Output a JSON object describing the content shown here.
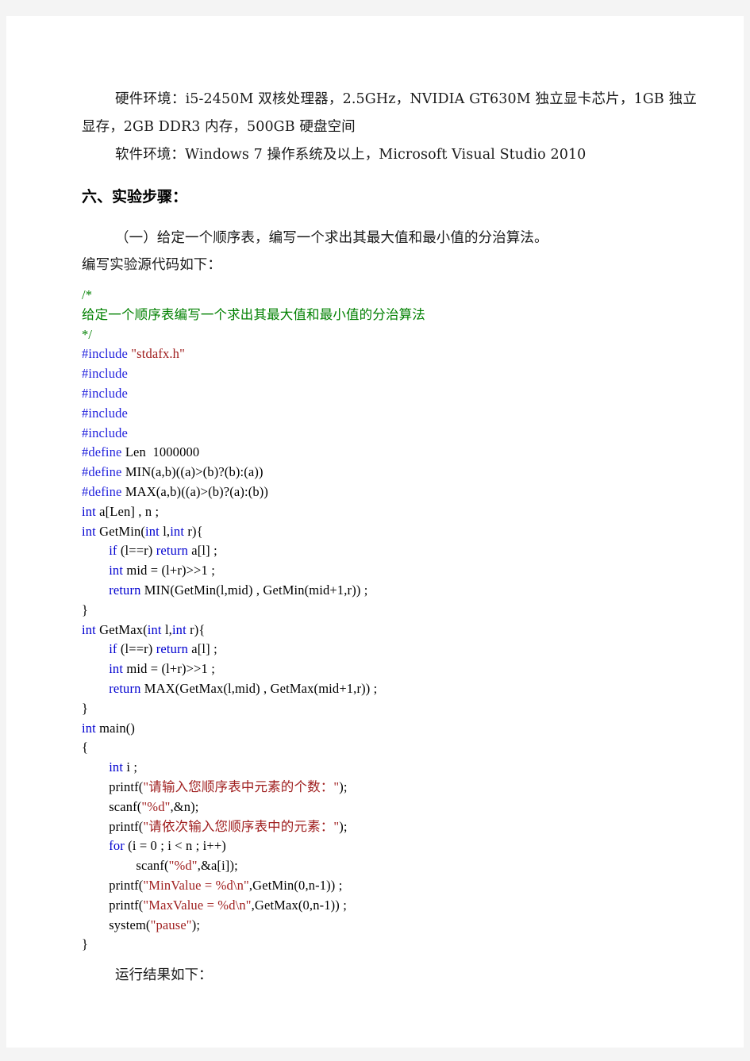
{
  "document": {
    "environment": {
      "hardware_line": "硬件环境：i5-2450M 双核处理器，2.5GHz，NVIDIA GT630M 独立显卡芯片，1GB 独立显存，2GB DDR3 内存，500GB 硬盘空间",
      "software_line": "软件环境：Windows 7 操作系统及以上，Microsoft Visual Studio 2010"
    },
    "section_heading": "六、实验步骤：",
    "subsection": "（一）给定一个顺序表，编写一个求出其最大值和最小值的分治算法。",
    "code_intro": "编写实验源代码如下：",
    "run_result_note": "运行结果如下："
  },
  "code": {
    "language": "c",
    "colors": {
      "keyword": "#0000d0",
      "preprocessor": "#2222dd",
      "string": "#a02020",
      "comment": "#008000",
      "plain": "#000000"
    },
    "lines": [
      [
        {
          "t": "/*",
          "c": "cmt"
        }
      ],
      [
        {
          "t": "给定一个顺序表编写一个求出其最大值和最小值的分治算法",
          "c": "cmt"
        }
      ],
      [
        {
          "t": "*/",
          "c": "cmt"
        }
      ],
      [
        {
          "t": "#include ",
          "c": "pp"
        },
        {
          "t": "\"stdafx.h\"",
          "c": "str"
        }
      ],
      [
        {
          "t": "#include",
          "c": "pp"
        }
      ],
      [
        {
          "t": "#include",
          "c": "pp"
        }
      ],
      [
        {
          "t": "#include",
          "c": "pp"
        }
      ],
      [
        {
          "t": "#include",
          "c": "pp"
        }
      ],
      [
        {
          "t": "#define ",
          "c": "pp"
        },
        {
          "t": "Len  1000000",
          "c": "pl"
        }
      ],
      [
        {
          "t": "#define ",
          "c": "pp"
        },
        {
          "t": "MIN(a,b)((a)>(b)?(b):(a))",
          "c": "pl"
        }
      ],
      [
        {
          "t": "#define ",
          "c": "pp"
        },
        {
          "t": "MAX(a,b)((a)>(b)?(a):(b))",
          "c": "pl"
        }
      ],
      [
        {
          "t": "int ",
          "c": "kw"
        },
        {
          "t": "a[Len] , n ;",
          "c": "pl"
        }
      ],
      [
        {
          "t": "int ",
          "c": "kw"
        },
        {
          "t": "GetMin(",
          "c": "pl"
        },
        {
          "t": "int ",
          "c": "kw"
        },
        {
          "t": "l,",
          "c": "pl"
        },
        {
          "t": "int ",
          "c": "kw"
        },
        {
          "t": "r){",
          "c": "pl"
        }
      ],
      [
        {
          "t": "        ",
          "c": "pl"
        },
        {
          "t": "if ",
          "c": "kw"
        },
        {
          "t": "(l==r) ",
          "c": "pl"
        },
        {
          "t": "return ",
          "c": "kw"
        },
        {
          "t": "a[l] ;",
          "c": "pl"
        }
      ],
      [
        {
          "t": "        ",
          "c": "pl"
        },
        {
          "t": "int ",
          "c": "kw"
        },
        {
          "t": "mid = (l+r)>>1 ;",
          "c": "pl"
        }
      ],
      [
        {
          "t": "        ",
          "c": "pl"
        },
        {
          "t": "return ",
          "c": "kw"
        },
        {
          "t": "MIN(GetMin(l,mid) , GetMin(mid+1,r)) ;",
          "c": "pl"
        }
      ],
      [
        {
          "t": "}",
          "c": "pl"
        }
      ],
      [
        {
          "t": "int ",
          "c": "kw"
        },
        {
          "t": "GetMax(",
          "c": "pl"
        },
        {
          "t": "int ",
          "c": "kw"
        },
        {
          "t": "l,",
          "c": "pl"
        },
        {
          "t": "int ",
          "c": "kw"
        },
        {
          "t": "r){",
          "c": "pl"
        }
      ],
      [
        {
          "t": "        ",
          "c": "pl"
        },
        {
          "t": "if ",
          "c": "kw"
        },
        {
          "t": "(l==r) ",
          "c": "pl"
        },
        {
          "t": "return ",
          "c": "kw"
        },
        {
          "t": "a[l] ;",
          "c": "pl"
        }
      ],
      [
        {
          "t": "        ",
          "c": "pl"
        },
        {
          "t": "int ",
          "c": "kw"
        },
        {
          "t": "mid = (l+r)>>1 ;",
          "c": "pl"
        }
      ],
      [
        {
          "t": "        ",
          "c": "pl"
        },
        {
          "t": "return ",
          "c": "kw"
        },
        {
          "t": "MAX(GetMax(l,mid) , GetMax(mid+1,r)) ;",
          "c": "pl"
        }
      ],
      [
        {
          "t": "}",
          "c": "pl"
        }
      ],
      [
        {
          "t": "int ",
          "c": "kw"
        },
        {
          "t": "main()",
          "c": "pl"
        }
      ],
      [
        {
          "t": "{",
          "c": "pl"
        }
      ],
      [
        {
          "t": "        ",
          "c": "pl"
        },
        {
          "t": "int ",
          "c": "kw"
        },
        {
          "t": "i ;",
          "c": "pl"
        }
      ],
      [
        {
          "t": "        printf(",
          "c": "pl"
        },
        {
          "t": "\"请输入您顺序表中元素的个数：\"",
          "c": "str"
        },
        {
          "t": ");",
          "c": "pl"
        }
      ],
      [
        {
          "t": "        scanf(",
          "c": "pl"
        },
        {
          "t": "\"%d\"",
          "c": "str"
        },
        {
          "t": ",&n);",
          "c": "pl"
        }
      ],
      [
        {
          "t": "        printf(",
          "c": "pl"
        },
        {
          "t": "\"请依次输入您顺序表中的元素：\"",
          "c": "str"
        },
        {
          "t": ");",
          "c": "pl"
        }
      ],
      [
        {
          "t": "        ",
          "c": "pl"
        },
        {
          "t": "for ",
          "c": "kw"
        },
        {
          "t": "(i = 0 ; i < n ; i++)",
          "c": "pl"
        }
      ],
      [
        {
          "t": "                scanf(",
          "c": "pl"
        },
        {
          "t": "\"%d\"",
          "c": "str"
        },
        {
          "t": ",&a[i]);",
          "c": "pl"
        }
      ],
      [
        {
          "t": "        printf(",
          "c": "pl"
        },
        {
          "t": "\"MinValue = %d\\n\"",
          "c": "str"
        },
        {
          "t": ",GetMin(0,n-1)) ;",
          "c": "pl"
        }
      ],
      [
        {
          "t": "        printf(",
          "c": "pl"
        },
        {
          "t": "\"MaxValue = %d\\n\"",
          "c": "str"
        },
        {
          "t": ",GetMax(0,n-1)) ;",
          "c": "pl"
        }
      ],
      [
        {
          "t": "        system(",
          "c": "pl"
        },
        {
          "t": "\"pause\"",
          "c": "str"
        },
        {
          "t": ");",
          "c": "pl"
        }
      ],
      [
        {
          "t": "}",
          "c": "pl"
        }
      ]
    ]
  }
}
